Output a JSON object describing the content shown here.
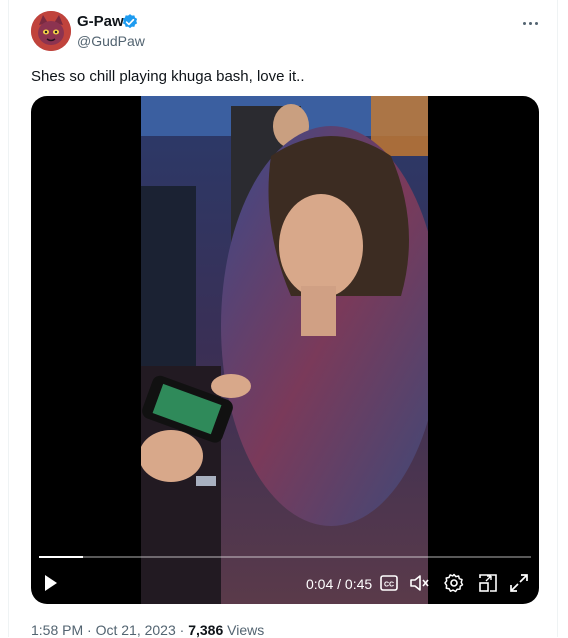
{
  "author": {
    "display_name": "G-Paw",
    "handle": "@GudPaw",
    "verified": true
  },
  "tweet": {
    "text": "Shes so chill playing khuga bash, love it.."
  },
  "video": {
    "current_time": "0:04",
    "separator": " / ",
    "duration": "0:45",
    "progress_fraction": 0.09,
    "controls": [
      "play-icon",
      "captions-icon",
      "mute-icon",
      "settings-icon",
      "pip-icon",
      "fullscreen-icon"
    ]
  },
  "meta": {
    "time": "1:58 PM",
    "dot1": " · ",
    "date": "Oct 21, 2023",
    "dot2": " · ",
    "views_count": "7,386",
    "views_label": " Views"
  },
  "colors": {
    "accent_blue": "#1d9bf0",
    "text_primary": "#0f1419",
    "text_secondary": "#536471",
    "video_bg": "#000000"
  }
}
